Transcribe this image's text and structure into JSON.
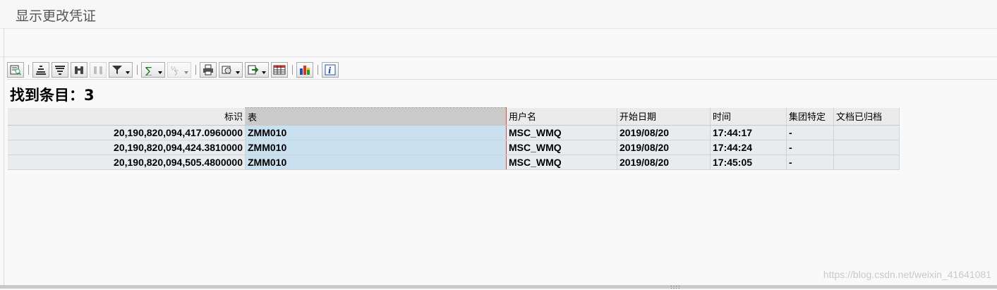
{
  "window": {
    "title": "显示更改凭证"
  },
  "toolbar": {
    "buttons": [
      {
        "icon": "details-icon"
      },
      {
        "icon": "sort-ascending-icon"
      },
      {
        "icon": "sort-descending-icon"
      },
      {
        "icon": "binoculars-find-icon"
      },
      {
        "icon": "find-next-icon",
        "disabled": true
      },
      {
        "icon": "filter-icon",
        "dropdown": true
      },
      {
        "icon": "sum-icon",
        "dropdown": true
      },
      {
        "icon": "subtotal-icon",
        "dropdown": true,
        "disabled": true
      },
      {
        "icon": "print-icon"
      },
      {
        "icon": "views-icon",
        "dropdown": true
      },
      {
        "icon": "export-icon",
        "dropdown": true
      },
      {
        "icon": "layout-grid-icon"
      },
      {
        "icon": "graphic-chart-icon"
      },
      {
        "icon": "info-icon"
      }
    ]
  },
  "result": {
    "label": "找到条目：",
    "count": "3"
  },
  "table": {
    "columns": [
      "标识",
      "表",
      "用户名",
      "开始日期",
      "时间",
      "集团特定",
      "文档已归档"
    ],
    "rows": [
      [
        "20,190,820,094,417.0960000",
        "ZMM010",
        "MSC_WMQ",
        "2019/08/20",
        "17:44:17",
        "-",
        ""
      ],
      [
        "20,190,820,094,424.3810000",
        "ZMM010",
        "MSC_WMQ",
        "2019/08/20",
        "17:44:24",
        "-",
        ""
      ],
      [
        "20,190,820,094,505.4800000",
        "ZMM010",
        "MSC_WMQ",
        "2019/08/20",
        "17:45:05",
        "-",
        ""
      ]
    ]
  },
  "watermark": "https://blog.csdn.net/weixin_41641081"
}
